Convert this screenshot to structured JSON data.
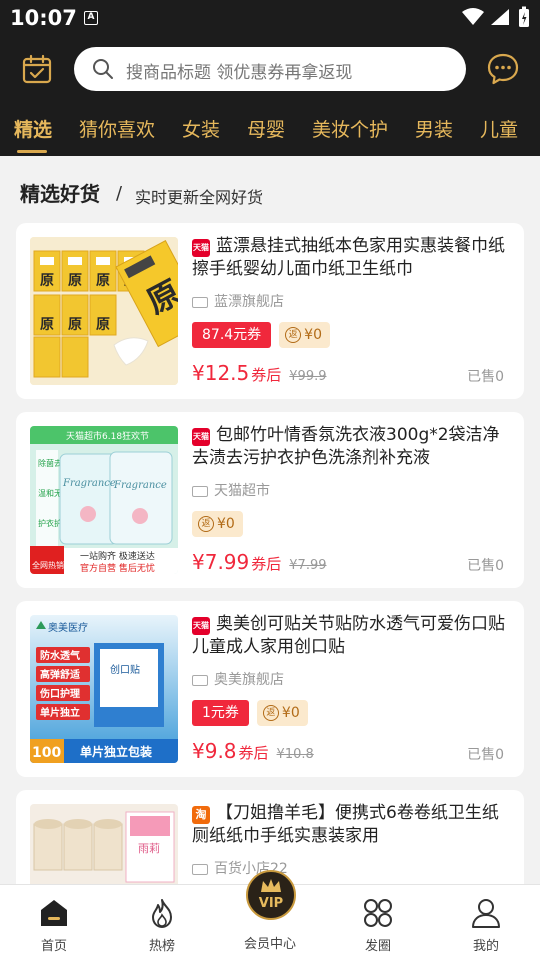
{
  "status_bar": {
    "time": "10:07",
    "notification_glyph": "A"
  },
  "header": {
    "search_placeholder": "搜商品标题 领优惠券再拿返现",
    "categories": [
      "精选",
      "猜你喜欢",
      "女装",
      "母婴",
      "美妆个护",
      "男装",
      "儿童"
    ],
    "active_category": "精选"
  },
  "section": {
    "title": "精选好货",
    "separator": "/",
    "subtitle": "实时更新全网好货"
  },
  "products": [
    {
      "platform_badge": "天猫",
      "title": "蓝漂悬挂式抽纸本色家用实惠装餐巾纸擦手纸婴幼儿面巾纸卫生纸巾",
      "store": "蓝漂旗舰店",
      "coupon": "87.4元券",
      "rebate": "¥0",
      "rebate_icon": "返",
      "price": "¥12.5",
      "price_suffix": "券后",
      "original_price": "¥99.9",
      "sold": "已售0"
    },
    {
      "platform_badge": "天猫",
      "title": "包邮竹叶情香氛洗衣液300g*2袋洁净去渍去污护衣护色洗涤剂补充液",
      "store": "天猫超市",
      "coupon": "",
      "rebate": "¥0",
      "rebate_icon": "返",
      "price": "¥7.99",
      "price_suffix": "券后",
      "original_price": "¥7.99",
      "sold": "已售0"
    },
    {
      "platform_badge": "天猫",
      "title": "奥美创可贴关节贴防水透气可爱伤口贴儿童成人家用创口贴",
      "store": "奥美旗舰店",
      "coupon": "1元券",
      "rebate": "¥0",
      "rebate_icon": "返",
      "price": "¥9.8",
      "price_suffix": "券后",
      "original_price": "¥10.8",
      "sold": "已售0"
    },
    {
      "platform_badge": "淘",
      "title": "【刀姐撸羊毛】便携式6卷卷纸卫生纸厕纸纸巾手纸实惠装家用",
      "store": "百货小店22"
    }
  ],
  "product_images": {
    "p1": {
      "brand": "原"
    },
    "p2": {
      "banner": "天猫超市6.18狂欢节",
      "brand": "Fragrance",
      "bottom_text": "一站购齐 极速送达",
      "bottom_text2": "官方自营 售后无忧",
      "corner_label": "全网热销",
      "side_tags": [
        "除菌去污",
        "温和无刺激",
        "护衣护色"
      ]
    },
    "p3": {
      "brand": "奥美医疗",
      "tags": [
        "防水透气",
        "高弹舒适",
        "伤口护理",
        "单片独立"
      ],
      "count": "100",
      "bottom_text": "单片独立包装",
      "box_label": "创口贴"
    },
    "p4": {
      "box_label": "雨莉"
    }
  },
  "tabbar": {
    "items": [
      "首页",
      "热榜",
      "会员中心",
      "发圈",
      "我的"
    ],
    "vip_text": "VIP"
  },
  "colors": {
    "accent_gold": "#e6b85c",
    "price_red": "#f0283c",
    "header_bg": "#1c1c1c"
  }
}
